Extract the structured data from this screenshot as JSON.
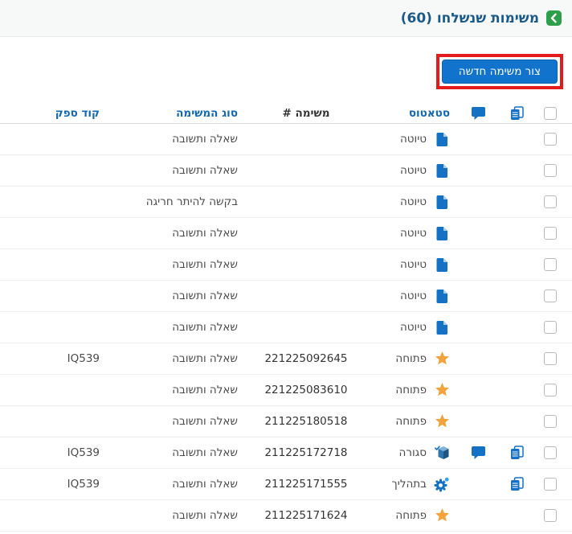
{
  "header": {
    "title": "משימות שנשלחו (60)",
    "chevron_icon": "chevron-left-icon"
  },
  "toolbar": {
    "new_task_button_label": "צור משימה חדשה"
  },
  "table": {
    "columns": {
      "copy_icon": "copy-document-icon",
      "comment_icon": "comment-bubble-icon",
      "status": "סטאטוס",
      "task_number": "# משימה",
      "task_type": "סוג המשימה",
      "supplier_code": "קוד ספק"
    },
    "rows": [
      {
        "status": "טיוטה",
        "status_icon": "draft-document",
        "task_number": "",
        "task_type": "שאלה ותשובה",
        "supplier_code": "",
        "has_comment": false,
        "has_copy": false
      },
      {
        "status": "טיוטה",
        "status_icon": "draft-document",
        "task_number": "",
        "task_type": "שאלה ותשובה",
        "supplier_code": "",
        "has_comment": false,
        "has_copy": false
      },
      {
        "status": "טיוטה",
        "status_icon": "draft-document",
        "task_number": "",
        "task_type": "בקשה להיתר חריגה",
        "supplier_code": "",
        "has_comment": false,
        "has_copy": false
      },
      {
        "status": "טיוטה",
        "status_icon": "draft-document",
        "task_number": "",
        "task_type": "שאלה ותשובה",
        "supplier_code": "",
        "has_comment": false,
        "has_copy": false
      },
      {
        "status": "טיוטה",
        "status_icon": "draft-document",
        "task_number": "",
        "task_type": "שאלה ותשובה",
        "supplier_code": "",
        "has_comment": false,
        "has_copy": false
      },
      {
        "status": "טיוטה",
        "status_icon": "draft-document",
        "task_number": "",
        "task_type": "שאלה ותשובה",
        "supplier_code": "",
        "has_comment": false,
        "has_copy": false
      },
      {
        "status": "טיוטה",
        "status_icon": "draft-document",
        "task_number": "",
        "task_type": "שאלה ותשובה",
        "supplier_code": "",
        "has_comment": false,
        "has_copy": false
      },
      {
        "status": "פתוחה",
        "status_icon": "open-star",
        "task_number": "221225092645",
        "task_type": "שאלה ותשובה",
        "supplier_code": "IQ539",
        "has_comment": false,
        "has_copy": false
      },
      {
        "status": "פתוחה",
        "status_icon": "open-star",
        "task_number": "221225083610",
        "task_type": "שאלה ותשובה",
        "supplier_code": "",
        "has_comment": false,
        "has_copy": false
      },
      {
        "status": "פתוחה",
        "status_icon": "open-star",
        "task_number": "211225180518",
        "task_type": "שאלה ותשובה",
        "supplier_code": "",
        "has_comment": false,
        "has_copy": false
      },
      {
        "status": "סגורה",
        "status_icon": "closed-box",
        "task_number": "211225172718",
        "task_type": "שאלה ותשובה",
        "supplier_code": "IQ539",
        "has_comment": true,
        "has_copy": true
      },
      {
        "status": "בתהליך",
        "status_icon": "in-progress-gear",
        "task_number": "211225171555",
        "task_type": "שאלה ותשובה",
        "supplier_code": "IQ539",
        "has_comment": false,
        "has_copy": true
      },
      {
        "status": "פתוחה",
        "status_icon": "open-star",
        "task_number": "211225171624",
        "task_type": "שאלה ותשובה",
        "supplier_code": "",
        "has_comment": false,
        "has_copy": false
      }
    ]
  },
  "colors": {
    "accent_blue": "#1471c4",
    "title_blue": "#1a5a8a",
    "link_blue": "#1068b3",
    "button_blue": "#1273cc",
    "annotation_red": "#e31b1b",
    "star_orange": "#f2a33c",
    "chevron_green": "#2d9e49"
  }
}
